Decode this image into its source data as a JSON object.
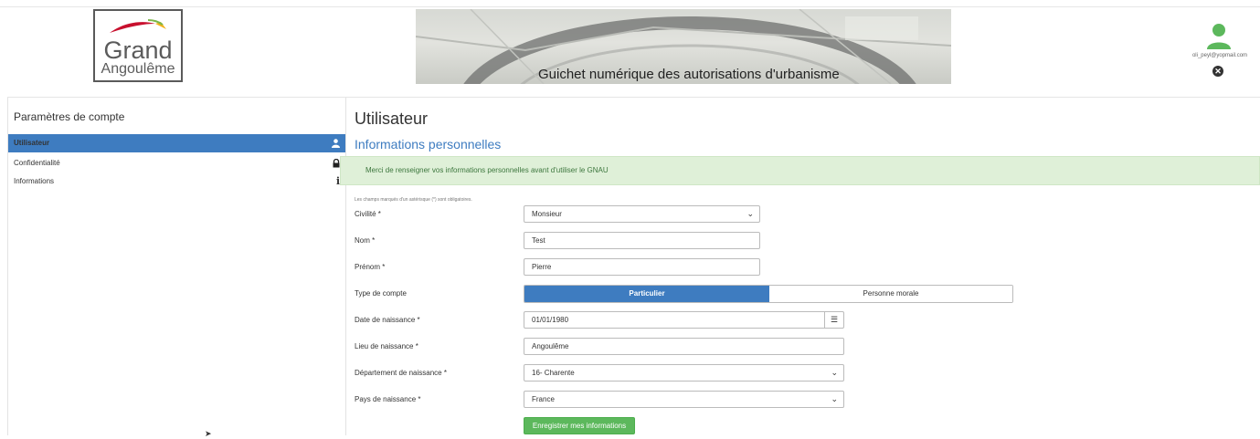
{
  "header": {
    "logo_line1": "Grand",
    "logo_line2": "Angoulême",
    "banner_title": "Guichet numérique des autorisations d'urbanisme",
    "user_email": "oli_peyl@yopmail.com"
  },
  "sidebar": {
    "title": "Paramètres de compte",
    "items": [
      {
        "label": "Utilisateur",
        "icon": "user-icon",
        "active": true
      },
      {
        "label": "Confidentialité",
        "icon": "lock-icon",
        "active": false
      },
      {
        "label": "Informations",
        "icon": "info-icon",
        "active": false
      }
    ]
  },
  "main": {
    "title": "Utilisateur",
    "subtitle": "Informations personnelles",
    "alert": "Merci de renseigner vos informations personnelles avant d'utiliser le GNAU",
    "required_hint": "Les champs marqués d'un astérisque (*) sont obligatoires.",
    "form": {
      "civilite": {
        "label": "Civilité *",
        "value": "Monsieur"
      },
      "nom": {
        "label": "Nom *",
        "value": "Test"
      },
      "prenom": {
        "label": "Prénom *",
        "value": "Pierre"
      },
      "type_compte": {
        "label": "Type de compte",
        "options": [
          "Particulier",
          "Personne morale"
        ],
        "selected": "Particulier"
      },
      "date_naissance": {
        "label": "Date de naissance *",
        "value": "01/01/1980"
      },
      "lieu_naissance": {
        "label": "Lieu de naissance *",
        "value": "Angoulême"
      },
      "departement_naissance": {
        "label": "Département de naissance *",
        "value": "16- Charente"
      },
      "pays_naissance": {
        "label": "Pays de naissance *",
        "value": "France"
      },
      "save_label": "Enregistrer mes informations"
    }
  },
  "colors": {
    "accent": "#3e7cc0",
    "success": "#5cb85c",
    "alert_bg": "#dff0d8",
    "avatar": "#5cb85c"
  }
}
